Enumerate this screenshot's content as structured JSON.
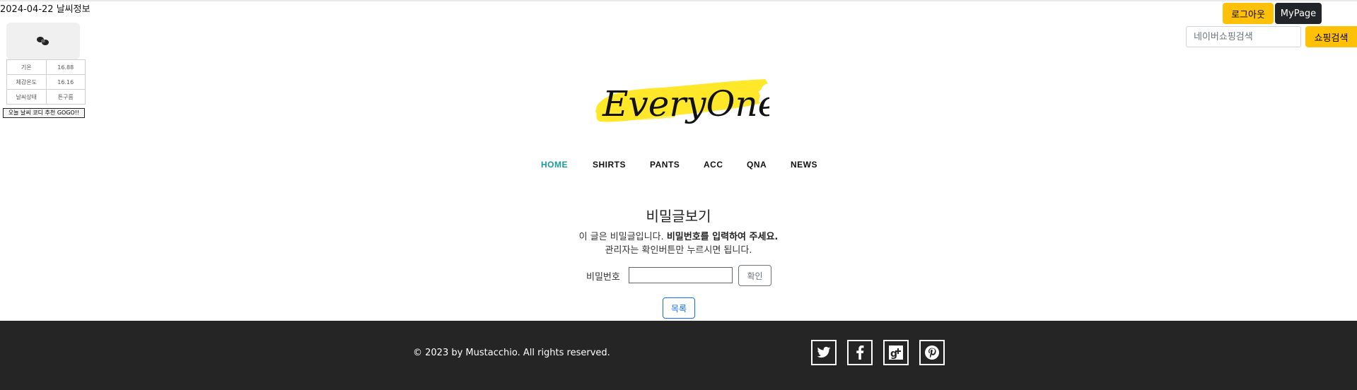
{
  "weather": {
    "date": "2024-04-22",
    "title_label": "날씨정보",
    "rows": [
      {
        "label": "기온",
        "value": "16.88"
      },
      {
        "label": "체감온도",
        "value": "16.16"
      },
      {
        "label": "날씨상태",
        "value": "튼구름"
      }
    ],
    "button_label": "오늘 날씨 코디 추천 GOGO!!"
  },
  "header": {
    "logout_label": "로그아웃",
    "mypage_label": "MyPage",
    "search_placeholder": "네이버쇼핑검색",
    "search_button_label": "쇼핑검색",
    "logo_text": "EveryOne"
  },
  "nav": {
    "items": [
      "HOME",
      "SHIRTS",
      "PANTS",
      "ACC",
      "QNA",
      "NEWS"
    ],
    "active": "HOME"
  },
  "main": {
    "title": "비밀글보기",
    "desc_normal": "이 글은 비밀글입니다. ",
    "desc_bold": "비밀번호를 입력하여 주세요.",
    "desc2": "관리자는 확인버튼만 누르시면 됩니다.",
    "password_label": "비밀번호",
    "password_value": "",
    "confirm_label": "확인",
    "list_label": "목록"
  },
  "footer": {
    "copyright": "© 2023 by Mustacchio. All rights reserved.",
    "social_icons": [
      "twitter-icon",
      "facebook-icon",
      "google-plus-icon",
      "pinterest-icon"
    ]
  },
  "colors": {
    "accent_yellow": "#ffc107",
    "nav_active": "#1a9b9b",
    "footer_bg": "#252525",
    "primary_blue": "#0d6efd"
  }
}
